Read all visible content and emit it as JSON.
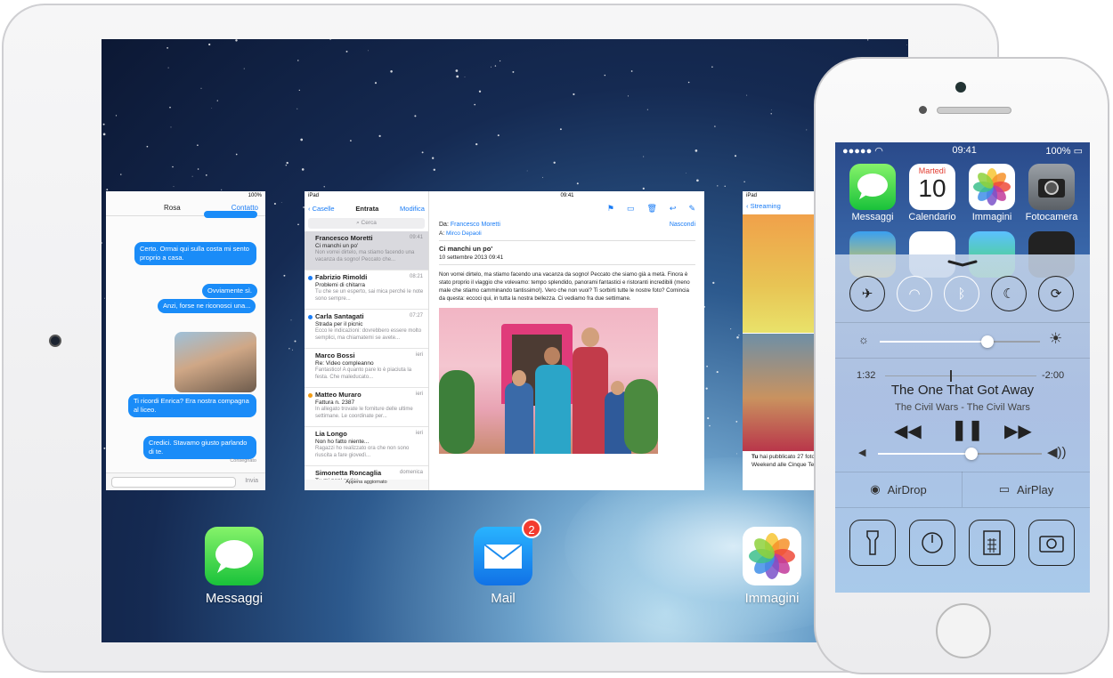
{
  "ipad": {
    "messages_card": {
      "status_battery": "100%",
      "contact_name": "Rosa",
      "contact_button": "Contatto",
      "bubbles": [
        "Certo. Ormai qui sulla costa mi sento proprio a casa.",
        "Ovviamente sì.",
        "Anzi, forse ne riconosci una...",
        "Ti ricordi Enrica? Era nostra compagna al liceo.",
        "Credici. Stavamo giusto parlando di te."
      ],
      "delivered": "Consegnato",
      "send_label": "Invia"
    },
    "mail_card": {
      "status_device": "iPad",
      "status_time": "09:41",
      "status_battery": "100%",
      "back_label": "Caselle",
      "title": "Entrata",
      "edit_label": "Modifica",
      "search_placeholder": "Cerca",
      "messages": [
        {
          "from": "Francesco Moretti",
          "date": "09:41",
          "subject": "Ci manchi un po'",
          "preview": "Non vorrei dirtelo, ma stiamo facendo una vacanza da sogno! Peccato che...",
          "dot": ""
        },
        {
          "from": "Fabrizio Rimoldi",
          "date": "08:21",
          "subject": "Problemi di chitarra",
          "preview": "Tu che se un esperto, sai mica perché le note sono sempre...",
          "dot": "#1a7cf5"
        },
        {
          "from": "Carla Santagati",
          "date": "07:27",
          "subject": "Strada per il picnic",
          "preview": "Ecco le indicazioni: dovrebbero essere molto semplici, ma chiamatemi se avete...",
          "dot": "#1a7cf5"
        },
        {
          "from": "Marco Bossi",
          "date": "ieri",
          "subject": "Re: Video compleanno",
          "preview": "Fantastico! A quanto pare lo è piaciuta la festa. Che maleducato...",
          "dot": ""
        },
        {
          "from": "Matteo Muraro",
          "date": "ieri",
          "subject": "Fattura n. 2387",
          "preview": "In allegato trovate le forniture delle ultime settimane. Le coordinate per...",
          "dot": "#f39c12"
        },
        {
          "from": "Lia Longo",
          "date": "ieri",
          "subject": "Non ho fatto niente...",
          "preview": "Ragazzi ho realizzato ora che non sono riuscita a fare giovedì...",
          "dot": ""
        },
        {
          "from": "Simonetta Roncaglia",
          "date": "domenica",
          "subject": "Tu mi pon' parlar...",
          "preview": "",
          "dot": ""
        }
      ],
      "updated_line1": "Appena aggiornato",
      "updated_line2": "2 non letto",
      "detail": {
        "from_label": "Da:",
        "from": "Francesco Moretti",
        "hide_label": "Nascondi",
        "to_label": "A:",
        "to": "Mirco Depaoli",
        "subject": "Ci manchi un po'",
        "date": "10 settembre 2013 09:41",
        "body": "Non vorrei dirtelo, ma stiamo facendo una vacanza da sogno! Peccato che siamo già a metà. Finora è stato proprio il viaggio che volevamo: tempo splendido, panorami fantastici e ristoranti incredibili (meno male che stiamo camminando tantissimo!). Vero che non vuoi? Ti sorbirti tutte le nostre foto? Comincia da questa: eccoci qui, in tutta la nostra bellezza. Ci vediamo fra due settimane."
      }
    },
    "photos_card": {
      "status_device": "iPad",
      "back_label": "Streaming",
      "caption_name": "Tu",
      "caption_line1": "hai pubblicato 27 foto",
      "caption_line2": "Weekend alle Cinque Terre"
    },
    "dock": [
      {
        "label": "Messaggi",
        "badge": ""
      },
      {
        "label": "Mail",
        "badge": "2"
      },
      {
        "label": "Immagini",
        "badge": ""
      }
    ]
  },
  "iphone": {
    "status_time": "09:41",
    "status_battery": "100%",
    "apps": [
      {
        "label": "Messaggi"
      },
      {
        "label": "Calendario",
        "weekday": "Martedì",
        "day": "10"
      },
      {
        "label": "Immagini"
      },
      {
        "label": "Fotocamera"
      }
    ],
    "control_center": {
      "toggles": [
        {
          "icon": "airplane-icon",
          "glyph": "✈",
          "on": false
        },
        {
          "icon": "wifi-icon",
          "glyph": "◠",
          "on": true
        },
        {
          "icon": "bluetooth-icon",
          "glyph": "ᛒ",
          "on": true
        },
        {
          "icon": "moon-icon",
          "glyph": "☾",
          "on": false
        },
        {
          "icon": "rotation-lock-icon",
          "glyph": "⟳",
          "on": false
        }
      ],
      "brightness_level": 0.67,
      "elapsed": "1:32",
      "remaining": "-2:00",
      "track_progress": 0.43,
      "song_title": "The One That Got Away",
      "song_artist": "The Civil Wars - The Civil Wars",
      "volume_level": 0.57,
      "airdrop_label": "AirDrop",
      "airplay_label": "AirPlay",
      "shortcuts": [
        "flashlight-icon",
        "timer-icon",
        "calculator-icon",
        "camera-icon"
      ]
    }
  }
}
